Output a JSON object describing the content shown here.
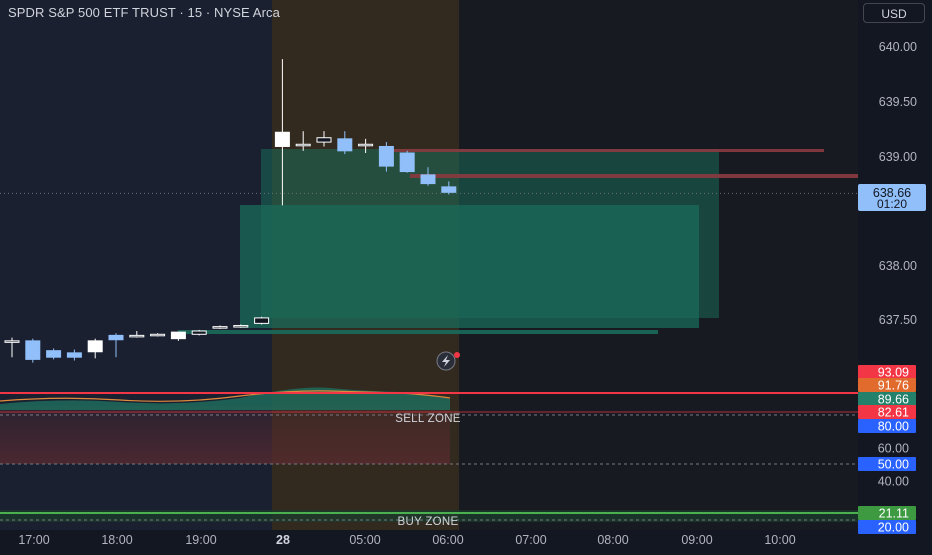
{
  "header": {
    "title": "SPDR S&P 500 ETF TRUST · 15 · NYSE Arca",
    "currency_label": "USD"
  },
  "colors": {
    "background": "#131722",
    "up_candle": "#ffffff",
    "down_candle": "#90bff9",
    "box_green": "#1a6b5a",
    "session_highlight": "#3a2e1f",
    "resistance_line": "#8b3a3f",
    "sell_line": "#f23645",
    "buy_line": "#4caf50",
    "tag_blue": "#2962ff",
    "tag_red": "#f23645",
    "tag_orange": "#e16a2d",
    "tag_teal": "#22806b",
    "tag_green": "#3d9a41"
  },
  "chart_data": {
    "type": "candlestick",
    "price_axis": {
      "ticks": [
        "640.00",
        "639.50",
        "639.00",
        "638.00",
        "637.50"
      ],
      "ylim": [
        637.1,
        640.2
      ],
      "last_price": "638.66",
      "countdown": "01:20"
    },
    "time_axis": {
      "labels": [
        "17:00",
        "18:00",
        "19:00",
        "28",
        "05:00",
        "06:00",
        "07:00",
        "08:00",
        "09:00",
        "10:00"
      ]
    },
    "candles": [
      {
        "o": 637.3,
        "h": 637.33,
        "l": 637.15,
        "c": 637.3,
        "dir": "up"
      },
      {
        "o": 637.3,
        "h": 637.32,
        "l": 637.1,
        "c": 637.13,
        "dir": "down"
      },
      {
        "o": 637.21,
        "h": 637.23,
        "l": 637.13,
        "c": 637.15,
        "dir": "down"
      },
      {
        "o": 637.19,
        "h": 637.22,
        "l": 637.12,
        "c": 637.15,
        "dir": "down"
      },
      {
        "o": 637.2,
        "h": 637.32,
        "l": 637.14,
        "c": 637.3,
        "dir": "up"
      },
      {
        "o": 637.35,
        "h": 637.37,
        "l": 637.15,
        "c": 637.31,
        "dir": "down"
      },
      {
        "o": 637.34,
        "h": 637.39,
        "l": 637.33,
        "c": 637.35,
        "dir": "up"
      },
      {
        "o": 637.35,
        "h": 637.37,
        "l": 637.34,
        "c": 637.36,
        "dir": "up"
      },
      {
        "o": 637.32,
        "h": 637.38,
        "l": 637.3,
        "c": 637.38,
        "dir": "up"
      },
      {
        "o": 637.36,
        "h": 637.4,
        "l": 637.35,
        "c": 637.39,
        "dir": "up"
      },
      {
        "o": 637.42,
        "h": 637.44,
        "l": 637.41,
        "c": 637.43,
        "dir": "up"
      },
      {
        "o": 637.44,
        "h": 637.45,
        "l": 637.42,
        "c": 637.44,
        "dir": "up"
      },
      {
        "o": 637.46,
        "h": 637.52,
        "l": 637.45,
        "c": 637.51,
        "dir": "up"
      },
      {
        "o": 639.08,
        "h": 639.88,
        "l": 638.54,
        "c": 639.21,
        "dir": "up"
      },
      {
        "o": 639.09,
        "h": 639.22,
        "l": 639.04,
        "c": 639.1,
        "dir": "up"
      },
      {
        "o": 639.12,
        "h": 639.22,
        "l": 639.08,
        "c": 639.16,
        "dir": "up"
      },
      {
        "o": 639.15,
        "h": 639.22,
        "l": 639.01,
        "c": 639.04,
        "dir": "down"
      },
      {
        "o": 639.1,
        "h": 639.15,
        "l": 639.02,
        "c": 639.1,
        "dir": "up"
      },
      {
        "o": 639.08,
        "h": 639.12,
        "l": 638.85,
        "c": 638.9,
        "dir": "down"
      },
      {
        "o": 639.02,
        "h": 639.04,
        "l": 638.84,
        "c": 638.85,
        "dir": "down"
      },
      {
        "o": 638.82,
        "h": 638.89,
        "l": 638.72,
        "c": 638.74,
        "dir": "down"
      },
      {
        "o": 638.71,
        "h": 638.76,
        "l": 638.64,
        "c": 638.66,
        "dir": "down"
      }
    ],
    "oscillator": {
      "tags": [
        {
          "label": "93.09",
          "color": "red"
        },
        {
          "label": "91.76",
          "color": "orange"
        },
        {
          "label": "89.66",
          "color": "teal"
        },
        {
          "label": "82.61",
          "color": "red"
        },
        {
          "label": "80.00",
          "color": "blue"
        },
        {
          "label": "60.00",
          "color": "plain"
        },
        {
          "label": "50.00",
          "color": "blue"
        },
        {
          "label": "40.00",
          "color": "plain"
        },
        {
          "label": "21.11",
          "color": "green"
        },
        {
          "label": "20.00",
          "color": "blue"
        }
      ],
      "sell_zone_label": "SELL ZONE",
      "buy_zone_label": "BUY ZONE"
    }
  }
}
